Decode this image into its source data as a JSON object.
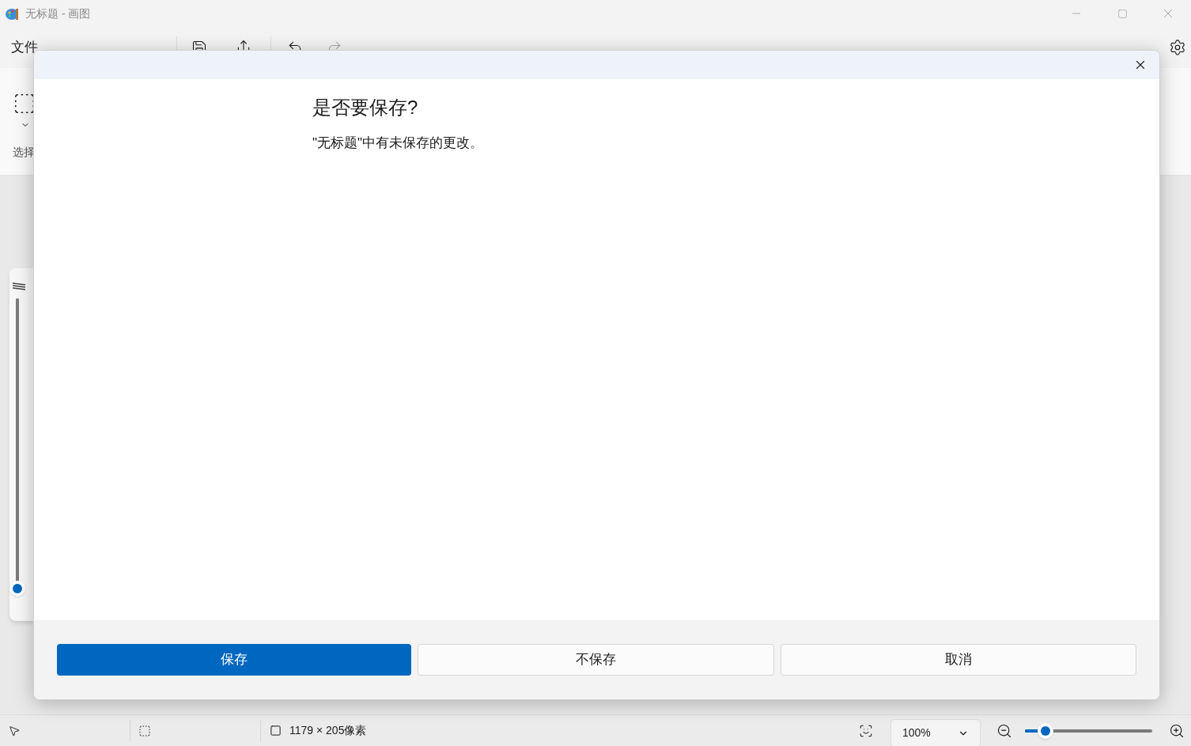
{
  "window": {
    "title": "无标题 - 画图"
  },
  "menu": [
    {
      "label": "文件"
    }
  ],
  "ribbon": {
    "select_label": "选择"
  },
  "brush_size_slider": {
    "level": 0.02
  },
  "status_bar": {
    "canvas_size": "1179 × 205像素",
    "zoom": "100%",
    "zoom_slider": {
      "level": 0.16
    }
  },
  "dialog": {
    "title": "是否要保存?",
    "message": "\"无标题\"中有未保存的更改。",
    "buttons": [
      {
        "label": "保存",
        "kind": "primary"
      },
      {
        "label": "不保存",
        "kind": "secondary"
      },
      {
        "label": "取消",
        "kind": "secondary"
      }
    ]
  }
}
